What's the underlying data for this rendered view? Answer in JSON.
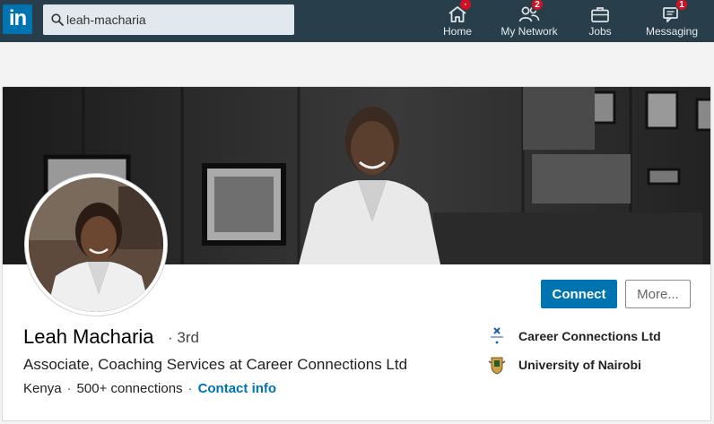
{
  "nav": {
    "logo_text": "in",
    "search": {
      "value": "leah-macharia"
    },
    "items": [
      {
        "label": "Home",
        "icon": "home-icon",
        "badge": "·"
      },
      {
        "label": "My Network",
        "icon": "people-icon",
        "badge": "2"
      },
      {
        "label": "Jobs",
        "icon": "briefcase-icon",
        "badge": ""
      },
      {
        "label": "Messaging",
        "icon": "chat-icon",
        "badge": "1"
      }
    ]
  },
  "profile": {
    "name": "Leah Macharia",
    "degree": "· 3rd",
    "headline": "Associate, Coaching Services at Career Connections Ltd",
    "location": "Kenya",
    "connections": "500+ connections",
    "contact_link": "Contact info",
    "actions": {
      "connect": "Connect",
      "more": "More..."
    },
    "experience": [
      {
        "name": "Career Connections Ltd",
        "icon": "career-connections-logo"
      },
      {
        "name": "University of Nairobi",
        "icon": "university-crest-logo"
      }
    ]
  },
  "colors": {
    "topbar": "#283e4a",
    "brand": "#0073b1",
    "badge": "#d11124"
  }
}
